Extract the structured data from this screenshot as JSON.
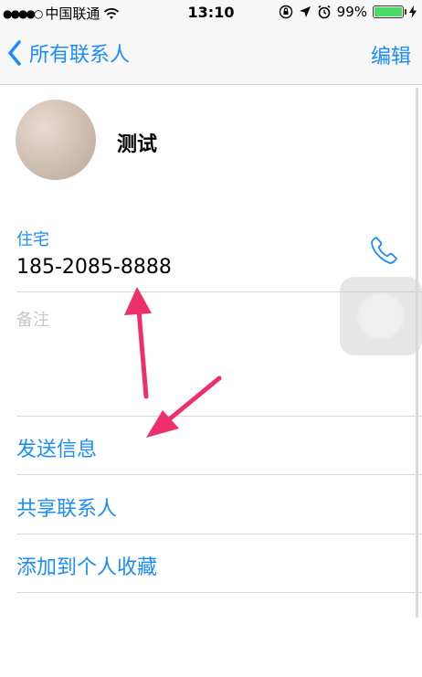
{
  "status_bar": {
    "signal": "●●●●○",
    "carrier": "中国联通",
    "time": "13:10",
    "battery_percent_text": "99%",
    "battery_level": 0.99,
    "battery_color": "#4cd964"
  },
  "nav": {
    "back_label": "所有联系人",
    "edit_label": "编辑"
  },
  "contact": {
    "name": "测试"
  },
  "phone": {
    "label": "住宅",
    "number": "185-2085-8888"
  },
  "notes": {
    "label": "备注"
  },
  "actions": [
    {
      "label": "发送信息"
    },
    {
      "label": "共享联系人"
    },
    {
      "label": "添加到个人收藏"
    }
  ],
  "colors": {
    "accent": "#1a8cff",
    "arrow": "#ef2f6b"
  },
  "icons": [
    "wifi-icon",
    "rotation-lock-icon",
    "location-icon",
    "alarm-icon",
    "charging-icon",
    "chevron-left-icon",
    "phone-icon"
  ]
}
